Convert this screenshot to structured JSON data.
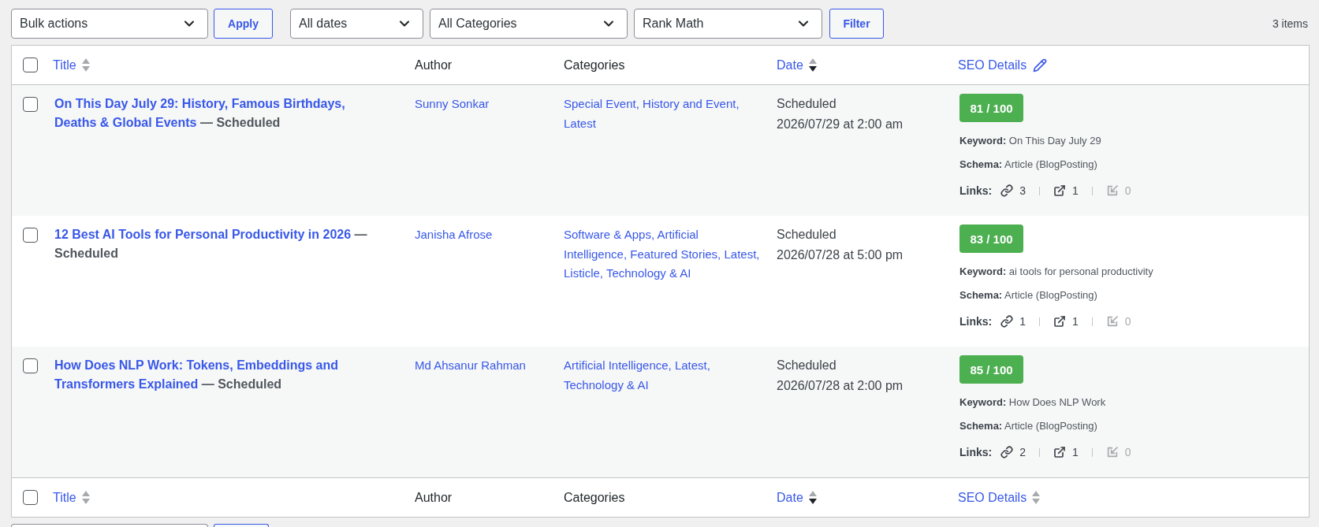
{
  "toolbar": {
    "bulk_action": "Bulk actions",
    "apply_button": "Apply",
    "filters": [
      "All dates",
      "All Categories",
      "Rank Math"
    ],
    "filter_button": "Filter",
    "items_count": "3 items"
  },
  "table": {
    "header": {
      "checked": false,
      "columns": [
        {
          "label": "Title",
          "kind": "sortable",
          "sorted": false
        },
        {
          "label": "Author",
          "kind": "plain"
        },
        {
          "label": "Categories",
          "kind": "plain"
        },
        {
          "label": "Date",
          "kind": "sortable",
          "sorted": true,
          "descending": true
        },
        {
          "label": "SEO Details",
          "kind": "editable"
        }
      ]
    },
    "rows": [
      {
        "checked": false,
        "title": "On This Day July 29: History, Famous Birthdays, Deaths & Global Events",
        "state": "— Scheduled",
        "author": "Sunny Sonkar",
        "categories": [
          "Special Event,",
          "History and Event,",
          "Latest"
        ],
        "status": "Scheduled",
        "date": "2026/07/29 at 2:00 am",
        "seo": {
          "score": "81 / 100",
          "keyword": "**Keyword:** On This Day July 29",
          "schema": "**Schema:** Article (BlogPosting)",
          "links_label": "Links:",
          "links": [
            {
              "kind": "internal",
              "count": "3",
              "disabled": false
            },
            {
              "kind": "external",
              "count": "1",
              "disabled": false
            },
            {
              "kind": "incoming",
              "count": "0",
              "disabled": true
            }
          ]
        }
      },
      {
        "checked": false,
        "title": "12 Best AI Tools for Personal Productivity in 2026",
        "state": "— Scheduled",
        "author": "Janisha Afrose",
        "categories": [
          "Software & Apps,",
          "Artificial Intelligence,",
          "Featured Stories,",
          "Latest,",
          "Listicle,",
          "Technology & AI"
        ],
        "status": "Scheduled",
        "date": "2026/07/28 at 5:00 pm",
        "seo": {
          "score": "83 / 100",
          "keyword": "**Keyword:** ai tools for personal productivity",
          "schema": "**Schema:** Article (BlogPosting)",
          "links_label": "Links:",
          "links": [
            {
              "kind": "internal",
              "count": "1",
              "disabled": false
            },
            {
              "kind": "external",
              "count": "1",
              "disabled": false
            },
            {
              "kind": "incoming",
              "count": "0",
              "disabled": true
            }
          ]
        }
      },
      {
        "checked": false,
        "title": "How Does NLP Work: Tokens, Embeddings and Transformers Explained",
        "state": "— Scheduled",
        "author": "Md Ahsanur Rahman",
        "categories": [
          "Artificial Intelligence,",
          "Latest,",
          "Technology & AI"
        ],
        "status": "Scheduled",
        "date": "2026/07/28 at 2:00 pm",
        "seo": {
          "score": "85 / 100",
          "keyword": "**Keyword:** How Does NLP Work",
          "schema": "**Schema:** Article (BlogPosting)",
          "links_label": "Links:",
          "links": [
            {
              "kind": "internal",
              "count": "2",
              "disabled": false
            },
            {
              "kind": "external",
              "count": "1",
              "disabled": false
            },
            {
              "kind": "incoming",
              "count": "0",
              "disabled": true
            }
          ]
        }
      }
    ],
    "footer": {
      "checked": false,
      "columns": [
        {
          "label": "Title",
          "kind": "sortable",
          "sorted": false
        },
        {
          "label": "Author",
          "kind": "plain"
        },
        {
          "label": "Categories",
          "kind": "plain"
        },
        {
          "label": "Date",
          "kind": "sortable",
          "sorted": true,
          "descending": true
        },
        {
          "label": "SEO Details",
          "kind": "sortable",
          "sorted": false
        }
      ]
    }
  }
}
